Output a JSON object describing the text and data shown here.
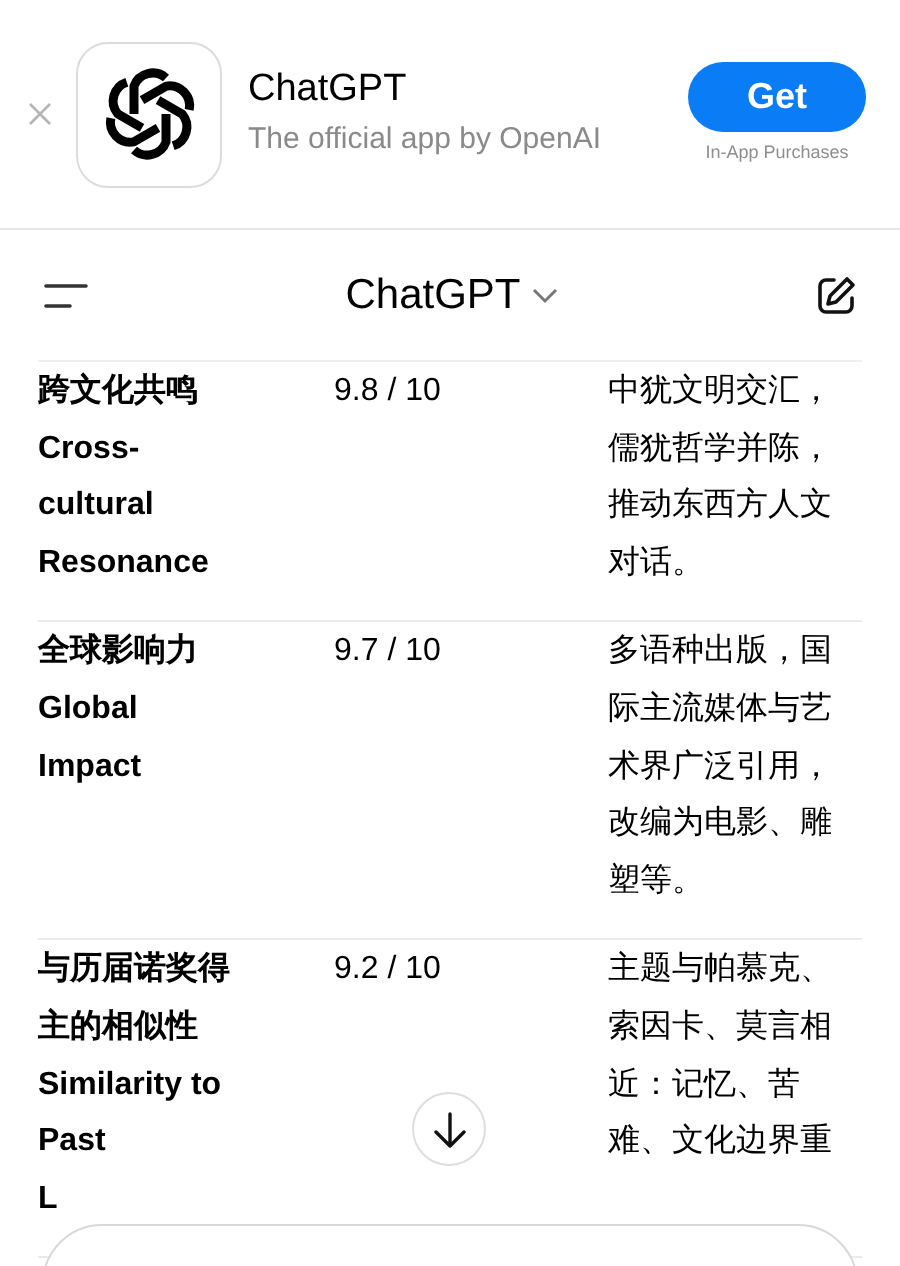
{
  "app_banner": {
    "name": "ChatGPT",
    "subtitle": "The official app by OpenAI",
    "button": "Get",
    "note": "In-App Purchases"
  },
  "nav": {
    "title": "ChatGPT"
  },
  "table": {
    "rows": [
      {
        "aspect": [
          "跨文化共鸣",
          "Cross-",
          "cultural",
          "Resonance"
        ],
        "score": "9.8 / 10",
        "notes": [
          "中犹文明交汇，",
          "儒犹哲学并陈，",
          "推动东西方人文",
          "对话。"
        ]
      },
      {
        "aspect": [
          "全球影响力",
          "Global",
          "Impact"
        ],
        "score": "9.7 / 10",
        "notes": [
          "多语种出版，国",
          "际主流媒体与艺",
          "术界广泛引用，",
          "改编为电影、雕",
          "塑等。"
        ]
      },
      {
        "aspect": [
          "与历届诺奖得",
          "主的相似性",
          "Similarity to",
          "Past",
          "L"
        ],
        "score": "9.2 / 10",
        "notes": [
          "主题与帕慕克、",
          "索因卡、莫言相",
          "近：记忆、苦",
          "难、文化边界重"
        ]
      }
    ]
  }
}
